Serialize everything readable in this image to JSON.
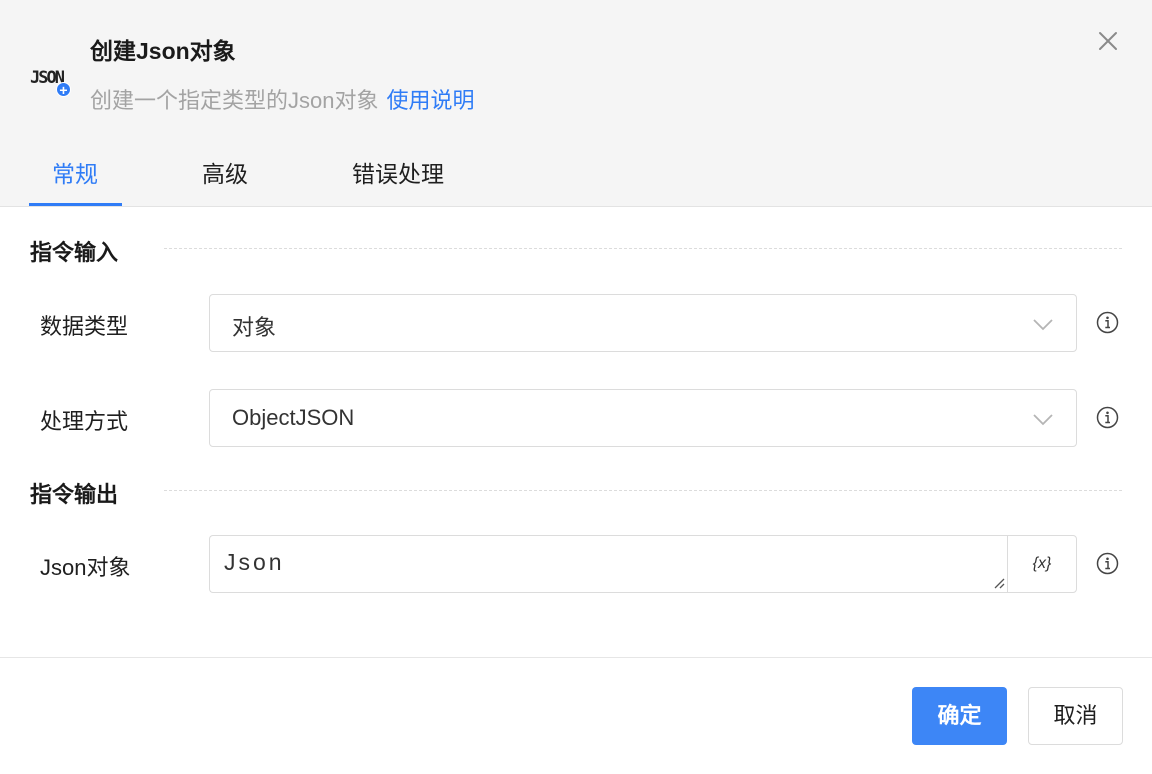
{
  "header": {
    "logo_text": "JSON",
    "title": "创建Json对象",
    "subtitle": "创建一个指定类型的Json对象",
    "help_link": "使用说明"
  },
  "tabs": [
    {
      "label": "常规",
      "active": true
    },
    {
      "label": "高级",
      "active": false
    },
    {
      "label": "错误处理",
      "active": false
    }
  ],
  "sections": {
    "input": {
      "title": "指令输入",
      "fields": [
        {
          "label": "数据类型",
          "value": "对象"
        },
        {
          "label": "处理方式",
          "value": "ObjectJSON"
        }
      ]
    },
    "output": {
      "title": "指令输出",
      "fields": [
        {
          "label": "Json对象",
          "value": "Json",
          "var_button": "{x}"
        }
      ]
    }
  },
  "footer": {
    "confirm_label": "确定",
    "cancel_label": "取消"
  },
  "colors": {
    "accent": "#2f7cf6",
    "primary_button": "#3d86f6",
    "header_bg": "#f5f5f5"
  }
}
